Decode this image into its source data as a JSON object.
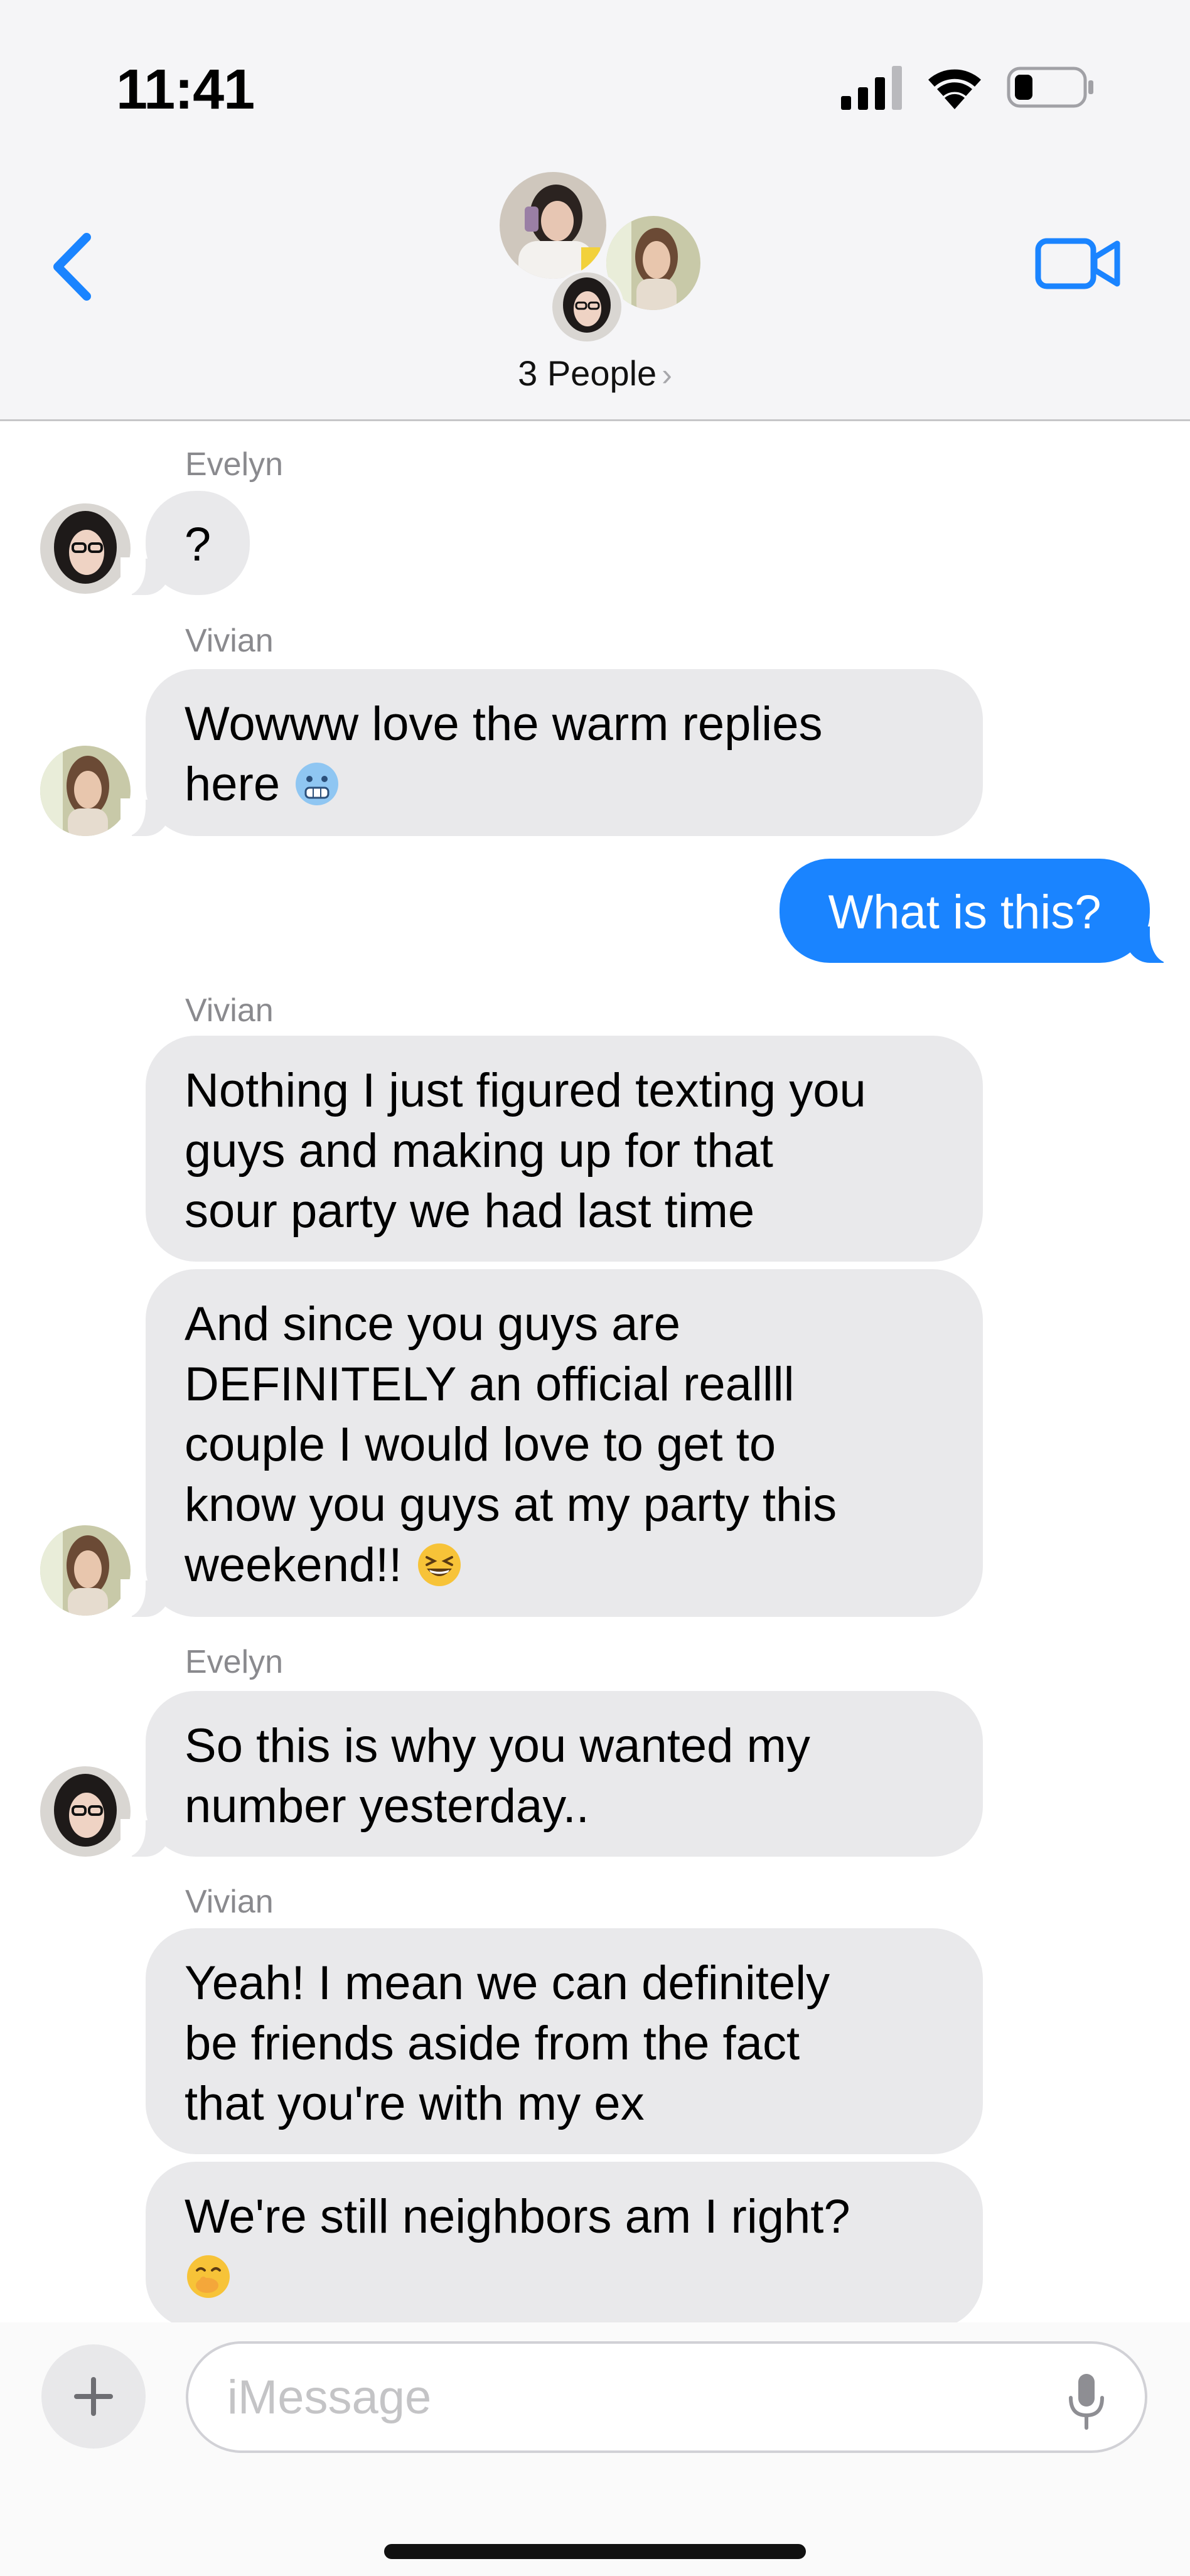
{
  "status_bar": {
    "time": "11:41",
    "battery_percent": 25
  },
  "header": {
    "title": "3 People",
    "title_chevron": "›",
    "back_icon": "chevron-left-icon",
    "video_icon": "video-camera-icon",
    "accent_color": "#1a84ff"
  },
  "messages": [
    {
      "sender": "Evelyn",
      "text": "?",
      "direction": "incoming"
    },
    {
      "sender": "Vivian",
      "lines": [
        "Wowww love the warm replies",
        "here"
      ],
      "emoji": "cold-face-emoji",
      "direction": "incoming"
    },
    {
      "text": "What is this?",
      "direction": "outgoing"
    },
    {
      "sender": "Vivian",
      "lines": [
        "Nothing I just figured texting you",
        "guys and making up for that",
        "sour party we had last time"
      ],
      "direction": "incoming"
    },
    {
      "lines": [
        "And since you guys are",
        "DEFINITELY an official reallll",
        "couple I would love to get to",
        "know you guys at my party this",
        "weekend!!"
      ],
      "emoji": "grinning-squinting-face-emoji",
      "direction": "incoming"
    },
    {
      "sender": "Evelyn",
      "lines": [
        "So this is why you wanted my",
        "number yesterday.."
      ],
      "direction": "incoming"
    },
    {
      "sender": "Vivian",
      "lines": [
        "Yeah! I mean we can definitely",
        "be friends aside from the fact",
        "that you're with my ex"
      ],
      "direction": "incoming"
    },
    {
      "lines": [
        "We're still neighbors am I right?"
      ],
      "emoji": "face-with-hand-over-mouth-emoji",
      "direction": "incoming"
    }
  ],
  "composer": {
    "placeholder": "iMessage",
    "add_label": "+",
    "mic_icon": "microphone-icon"
  },
  "colors": {
    "incoming_bubble": "#e9e9eb",
    "outgoing_bubble": "#1a84ff",
    "sender_name": "#8a8a8e"
  }
}
